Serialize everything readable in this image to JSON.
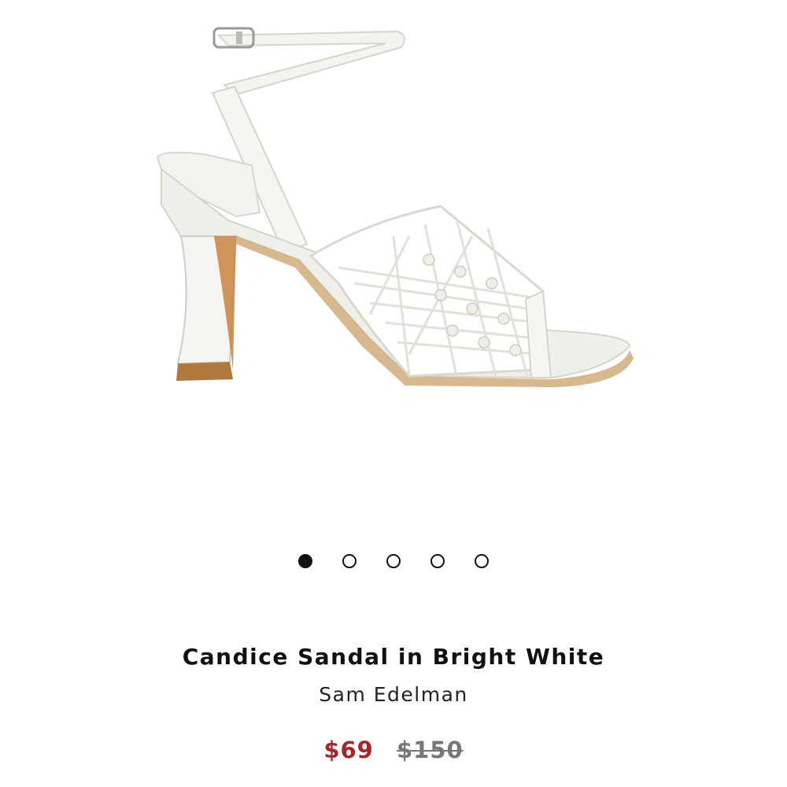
{
  "product": {
    "image_icon": "white-sandal-product-image",
    "title": "Candice Sandal in Bright White",
    "brand": "Sam Edelman",
    "sale_price": "$69",
    "original_price": "$150",
    "sale_color": "#a3262c"
  },
  "carousel": {
    "count": 5,
    "active_index": 0
  }
}
